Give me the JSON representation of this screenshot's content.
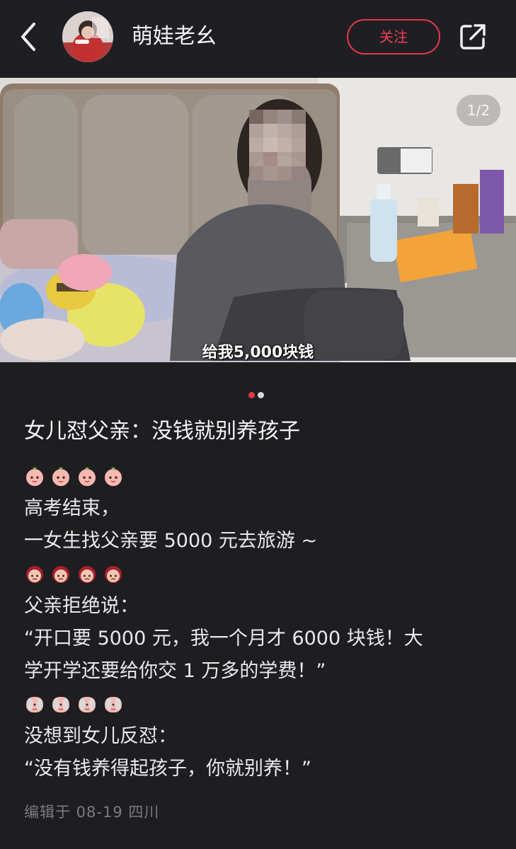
{
  "header": {
    "author_name": "萌娃老幺",
    "follow_label": "关注",
    "back_icon": "chevron-left-icon",
    "share_icon": "share-external-icon",
    "accent_color": "#e8364c"
  },
  "media": {
    "counter": "1/2",
    "subtitle": "给我5,000块钱",
    "current_index": 1,
    "total": 2
  },
  "post": {
    "title": "女儿怼父亲：没钱就别养孩子",
    "lines": {
      "l1": "高考结束，",
      "l2": "一女生找父亲要 5000 元去旅游 ~",
      "l3": "父亲拒绝说：",
      "l4": "“开口要 5000 元，我一个月才 6000 块钱！大",
      "l5": "学开学还要给你交 1 万多的学费！”",
      "l6": "没想到女儿反怼：",
      "l7": "“没有钱养得起孩子，你就别养！”"
    },
    "emoji_rows": [
      "peach-face-emoji",
      "angry-girl-emoji",
      "facepalm-emoji"
    ],
    "meta": "编辑于 08-19 四川"
  },
  "colors": {
    "background": "#1e1e21",
    "dot_active": "#e8364c",
    "dot_inactive": "#d8d8d8"
  }
}
